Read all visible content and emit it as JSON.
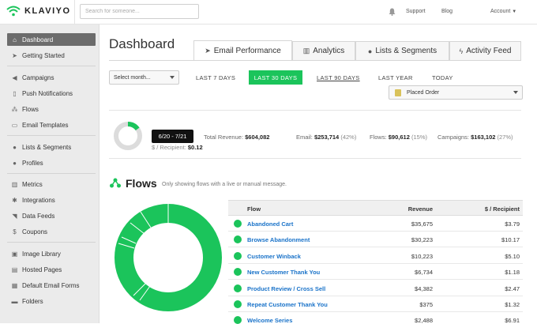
{
  "header": {
    "logo_text": "KLAVIYO",
    "search_placeholder": "Search for someone...",
    "support": "Support",
    "blog": "Blog",
    "account": "Account"
  },
  "sidebar": {
    "items": [
      {
        "label": "Dashboard",
        "icon": "home-icon"
      },
      {
        "label": "Getting Started",
        "icon": "paper-plane-icon"
      },
      {
        "label": "Campaigns",
        "icon": "megaphone-icon"
      },
      {
        "label": "Push Notifications",
        "icon": "push-icon"
      },
      {
        "label": "Flows",
        "icon": "flows-icon"
      },
      {
        "label": "Email Templates",
        "icon": "template-icon"
      },
      {
        "label": "Lists & Segments",
        "icon": "users-icon"
      },
      {
        "label": "Profiles",
        "icon": "user-icon"
      },
      {
        "label": "Metrics",
        "icon": "bar-chart-icon"
      },
      {
        "label": "Integrations",
        "icon": "gear-icon"
      },
      {
        "label": "Data Feeds",
        "icon": "rss-icon"
      },
      {
        "label": "Coupons",
        "icon": "dollar-icon"
      },
      {
        "label": "Image Library",
        "icon": "image-icon"
      },
      {
        "label": "Hosted Pages",
        "icon": "file-icon"
      },
      {
        "label": "Default Email Forms",
        "icon": "form-icon"
      },
      {
        "label": "Folders",
        "icon": "folder-icon"
      }
    ]
  },
  "main": {
    "title": "Dashboard",
    "tabs": [
      {
        "label": "Email Performance",
        "icon": "paper-plane-icon"
      },
      {
        "label": "Analytics",
        "icon": "bar-chart-icon"
      },
      {
        "label": "Lists & Segments",
        "icon": "users-icon"
      },
      {
        "label": "Activity Feed",
        "icon": "bolt-icon"
      }
    ],
    "select_month": "Select month...",
    "ranges": [
      "LAST 7 DAYS",
      "LAST 30 DAYS",
      "LAST 90 DAYS",
      "LAST YEAR",
      "TODAY"
    ],
    "metric_select": "Placed Order"
  },
  "summary": {
    "tooltip": "6/20 - 7/21",
    "total_revenue_label": "Total Revenue:",
    "total_revenue": "$604,082",
    "email_label": "Email:",
    "email_value": "$253,714",
    "email_pct": "(42%)",
    "flows_label": "Flows:",
    "flows_value": "$90,612",
    "flows_pct": "(15%)",
    "campaigns_label": "Campaigns:",
    "campaigns_value": "$163,102",
    "campaigns_pct": "(27%)",
    "per_recipient_label": "$ / Recipient:",
    "per_recipient_value": "$0.12",
    "donut_share": 0.15
  },
  "flows": {
    "title": "Flows",
    "subtitle": "Only showing flows with a live or manual message.",
    "columns": [
      "Flow",
      "Revenue",
      "$ / Recipient"
    ],
    "rows": [
      {
        "name": "Abandoned Cart",
        "revenue": "$35,675",
        "per_recipient": "$3.79"
      },
      {
        "name": "Browse Abandonment",
        "revenue": "$30,223",
        "per_recipient": "$10.17"
      },
      {
        "name": "Customer Winback",
        "revenue": "$10,223",
        "per_recipient": "$5.10"
      },
      {
        "name": "New Customer Thank You",
        "revenue": "$6,734",
        "per_recipient": "$1.18"
      },
      {
        "name": "Product Review / Cross Sell",
        "revenue": "$4,382",
        "per_recipient": "$2.47"
      },
      {
        "name": "Repeat Customer Thank You",
        "revenue": "$375",
        "per_recipient": "$1.32"
      },
      {
        "name": "Welcome Series",
        "revenue": "$2,488",
        "per_recipient": "$6.91"
      }
    ]
  },
  "colors": {
    "accent": "#1bc45b",
    "link": "#1a73c9",
    "sidebar_active": "#6c6c6c"
  }
}
